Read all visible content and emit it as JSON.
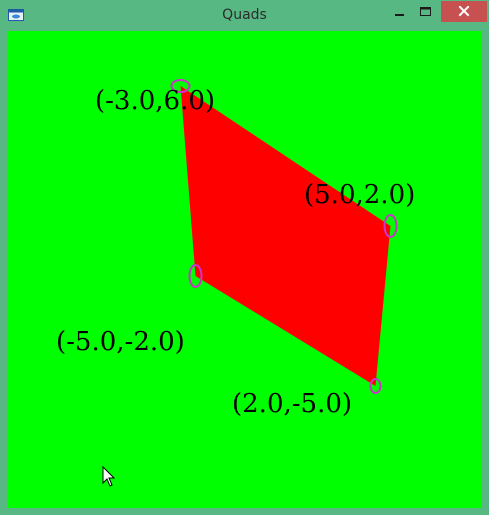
{
  "window": {
    "title": "Quads"
  },
  "titlebar": {
    "app_icon": "window-icon",
    "minimize_icon": "minimize-icon",
    "maximize_icon": "maximize-icon",
    "close_icon": "close-icon"
  },
  "colors": {
    "frame": "#58b884",
    "background": "#00ff00",
    "quad_fill": "#ff0000",
    "marker": "#cc33cc",
    "close_button": "#c75050"
  },
  "scene": {
    "vertices": [
      {
        "label": "(-3.0,6.0)",
        "x": -3.0,
        "y": 6.0
      },
      {
        "label": "(5.0,2.0)",
        "x": 5.0,
        "y": 2.0
      },
      {
        "label": "(2.0,-5.0)",
        "x": 2.0,
        "y": -5.0
      },
      {
        "label": "(-5.0,-2.0)",
        "x": -5.0,
        "y": -2.0
      }
    ]
  }
}
